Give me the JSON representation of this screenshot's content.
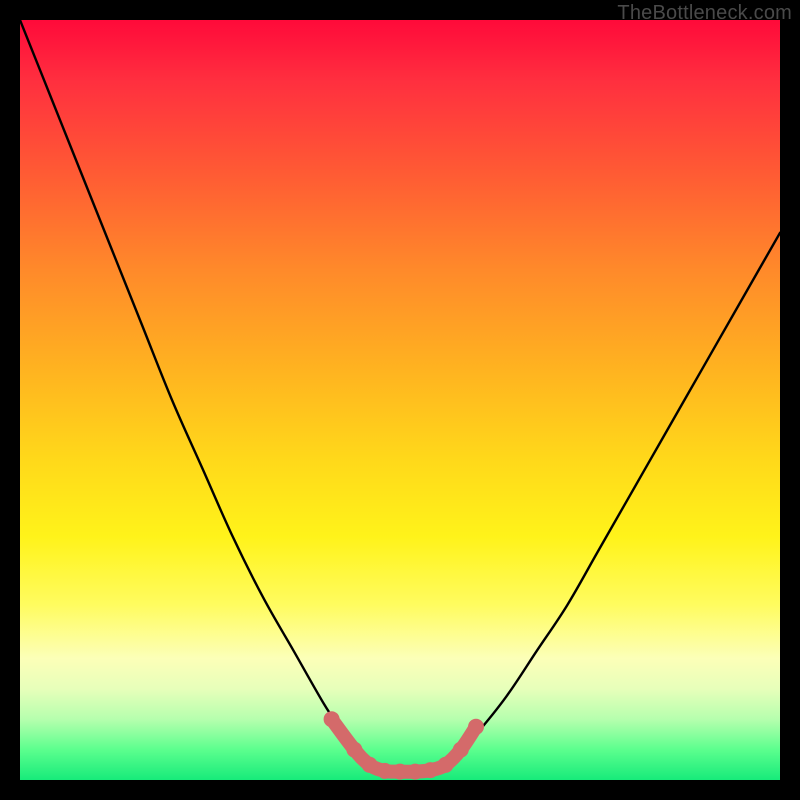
{
  "watermark": "TheBottleneck.com",
  "chart_data": {
    "type": "line",
    "title": "",
    "xlabel": "",
    "ylabel": "",
    "xlim": [
      0,
      100
    ],
    "ylim": [
      0,
      100
    ],
    "grid": false,
    "legend": false,
    "series": [
      {
        "name": "left-curve",
        "color": "#000000",
        "x": [
          0,
          4,
          8,
          12,
          16,
          20,
          24,
          28,
          32,
          36,
          40,
          42,
          44,
          46
        ],
        "y": [
          100,
          90,
          80,
          70,
          60,
          50,
          41,
          32,
          24,
          17,
          10,
          7,
          4,
          2
        ]
      },
      {
        "name": "right-curve",
        "color": "#000000",
        "x": [
          56,
          58,
          60,
          64,
          68,
          72,
          76,
          80,
          84,
          88,
          92,
          96,
          100
        ],
        "y": [
          2,
          4,
          6,
          11,
          17,
          23,
          30,
          37,
          44,
          51,
          58,
          65,
          72
        ]
      },
      {
        "name": "valley-highlight",
        "color": "#d46a6a",
        "width": 12,
        "x": [
          41,
          44,
          46,
          48,
          50,
          52,
          54,
          56,
          58,
          60
        ],
        "y": [
          8,
          4,
          2,
          1.2,
          1.1,
          1.1,
          1.3,
          2,
          4,
          7
        ]
      }
    ],
    "background_gradient": {
      "stops": [
        {
          "pos": 0,
          "color": "#ff0a3a"
        },
        {
          "pos": 20,
          "color": "#ff5a34"
        },
        {
          "pos": 46,
          "color": "#ffb320"
        },
        {
          "pos": 68,
          "color": "#fff31a"
        },
        {
          "pos": 88,
          "color": "#e7ffba"
        },
        {
          "pos": 100,
          "color": "#17eb7a"
        }
      ]
    }
  }
}
